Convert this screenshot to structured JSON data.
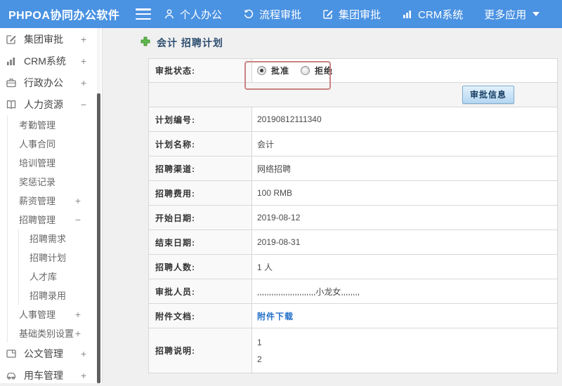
{
  "navbar": {
    "brand": "PHPOA协同办公软件",
    "items": [
      {
        "label": "个人办公",
        "icon": "user-icon"
      },
      {
        "label": "流程审批",
        "icon": "history-icon"
      },
      {
        "label": "集团审批",
        "icon": "edit-icon"
      },
      {
        "label": "CRM系统",
        "icon": "bar-chart-icon"
      },
      {
        "label": "更多应用",
        "icon": "caret-down-icon"
      }
    ]
  },
  "sidebar": {
    "items": [
      {
        "label": "集团审批",
        "expand": "+",
        "icon": "edit-icon"
      },
      {
        "label": "CRM系统",
        "expand": "+",
        "icon": "bar-chart-icon"
      },
      {
        "label": "行政办公",
        "expand": "+",
        "icon": "briefcase-icon"
      },
      {
        "label": "人力资源",
        "expand": "−",
        "icon": "book-icon"
      },
      {
        "label": "考勤管理",
        "expand": ""
      },
      {
        "label": "人事合同",
        "expand": ""
      },
      {
        "label": "培训管理",
        "expand": ""
      },
      {
        "label": "奖惩记录",
        "expand": ""
      },
      {
        "label": "薪资管理",
        "expand": "+"
      },
      {
        "label": "招聘管理",
        "expand": "−"
      },
      {
        "label": "招聘需求",
        "expand": ""
      },
      {
        "label": "招聘计划",
        "expand": ""
      },
      {
        "label": "人才库",
        "expand": ""
      },
      {
        "label": "招聘录用",
        "expand": ""
      },
      {
        "label": "人事管理",
        "expand": "+"
      },
      {
        "label": "基础类别设置",
        "expand": "+"
      },
      {
        "label": "公文管理",
        "expand": "+",
        "icon": "document-icon"
      },
      {
        "label": "用车管理",
        "expand": "+",
        "icon": "car-icon"
      }
    ]
  },
  "main": {
    "title": "会计 招聘计划",
    "form": {
      "status_label": "审批状态:",
      "radio_approve": "批准",
      "radio_reject": "拒绝",
      "button_label": "审批信息",
      "rows": [
        {
          "label": "计划编号:",
          "value": "20190812111340"
        },
        {
          "label": "计划名称:",
          "value": "会计"
        },
        {
          "label": "招聘渠道:",
          "value": "网络招聘"
        },
        {
          "label": "招聘费用:",
          "value": "100 RMB"
        },
        {
          "label": "开始日期:",
          "value": "2019-08-12"
        },
        {
          "label": "结束日期:",
          "value": "2019-08-31"
        },
        {
          "label": "招聘人数:",
          "value": "1 人"
        },
        {
          "label": "审批人员:",
          "value": ",,,,,,,,,,,,,,,,,,,,,,,,,小龙女,,,,,,,,"
        }
      ],
      "attachment_label": "附件文档:",
      "attachment_link": "附件下载",
      "desc_label": "招聘说明:",
      "desc_line1": "1",
      "desc_line2": "2"
    }
  },
  "colors": {
    "navbar_blue": "#4a92e2",
    "highlight_red": "#ca8383",
    "link_blue": "#2470c8",
    "button_blue": "#b4d6f1",
    "title_navy": "#2e4e70",
    "add_icon_green": "#62b84e"
  }
}
